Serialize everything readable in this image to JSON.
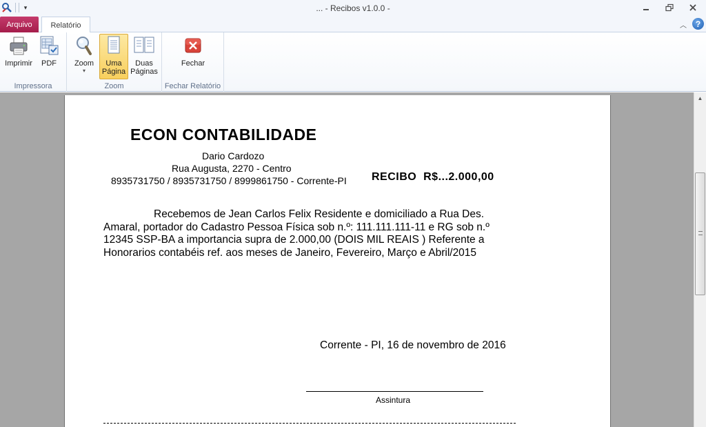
{
  "window": {
    "title": "... - Recibos v1.0.0 -"
  },
  "tabs": {
    "file": "Arquivo",
    "report": "Relatório"
  },
  "ribbon": {
    "groups": [
      {
        "label": "Impressora",
        "buttons": [
          {
            "label": "Imprimir",
            "icon": "printer-icon"
          },
          {
            "label": "PDF",
            "icon": "pdf-icon"
          }
        ]
      },
      {
        "label": "Zoom",
        "buttons": [
          {
            "label": "Zoom",
            "icon": "magnifier-icon"
          },
          {
            "label": "Uma Página",
            "line1": "Uma",
            "line2": "Página",
            "icon": "single-page-icon",
            "active": true
          },
          {
            "label": "Duas Páginas",
            "line1": "Duas",
            "line2": "Páginas",
            "icon": "two-pages-icon"
          }
        ]
      },
      {
        "label": "Fechar Relatório",
        "buttons": [
          {
            "label": "Fechar",
            "icon": "close-report-icon"
          }
        ]
      }
    ]
  },
  "receipt": {
    "company": "ECON CONTABILIDADE",
    "contact_name": "Dario Cardozo",
    "address": "Rua Augusta, 2270 - Centro",
    "phones_city": "8935731750 / 8935731750 / 8999861750 - Corrente-PI",
    "title": "RECIBO  R$...2.000,00",
    "body": "Recebemos de Jean Carlos Felix Residente e domiciliado a Rua Des. Amaral, portador do Cadastro Pessoa Física sob n.º: 111.111.111-11 e RG sob n.º 12345 SSP-BA a importancia supra de 2.000,00 (DOIS MIL REAIS ) Referente a Honorarios contabéis ref. aos meses de Janeiro, Fevereiro, Março e Abril/2015",
    "place_date": "Corrente - PI, 16 de novembro de 2016",
    "signature_label": "Assintura"
  },
  "colors": {
    "file_tab": "#b1265a",
    "active_button": "#f8cf5d",
    "workspace": "#a6a6a6"
  }
}
